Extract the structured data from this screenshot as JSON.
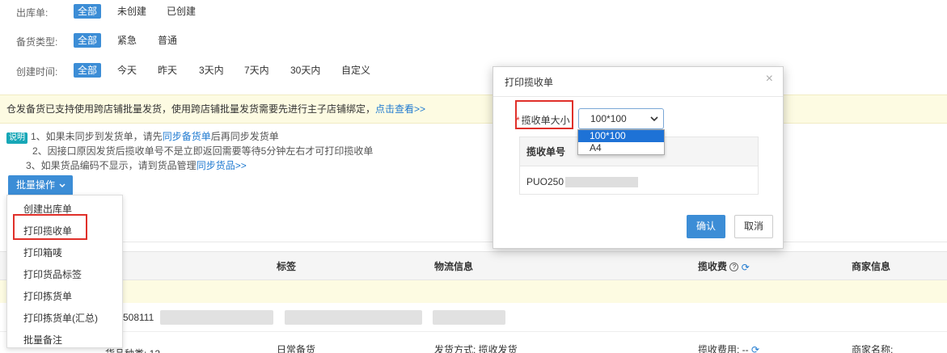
{
  "filters": {
    "outbound": {
      "label": "出库单:",
      "options": [
        "全部",
        "未创建",
        "已创建"
      ],
      "active": "全部"
    },
    "stock_type": {
      "label": "备货类型:",
      "options": [
        "全部",
        "紧急",
        "普通"
      ],
      "active": "全部"
    },
    "created_time": {
      "label": "创建时间:",
      "options": [
        "全部",
        "今天",
        "昨天",
        "3天内",
        "7天内",
        "30天内",
        "自定义"
      ],
      "active": "全部"
    }
  },
  "notice": {
    "text": "仓发备货已支持使用跨店铺批量发货，使用跨店铺批量发货需要先进行主子店铺绑定，",
    "link": "点击查看>>"
  },
  "tips": {
    "badge": "说明",
    "line1_pre": "1、如果未同步到发货单，请先",
    "line1_link": "同步备货单",
    "line1_post": "后再同步发货单",
    "line2": "2、因接口原因发货后揽收单号不是立即返回需要等待5分钟左右才可打印揽收单",
    "line3_pre": "3、如果货品编码不显示，请到货品管理",
    "line3_link": "同步货品>>"
  },
  "batch_button": {
    "label": "批量操作",
    "chevron": "chevron-down-icon"
  },
  "batch_menu": [
    "创建出库单",
    "打印揽收单",
    "打印箱唛",
    "打印货品标签",
    "打印拣货单",
    "打印拣货单(汇总)",
    "批量备注"
  ],
  "table": {
    "headers": [
      "标签",
      "物流信息",
      "揽收费",
      "商家信息"
    ],
    "row": {
      "id_partial": "508111",
      "goods_kinds": "货品种类: 12",
      "stock_type": "日常备货",
      "ship_method": "发货方式: 揽收发货",
      "pickup_fee": "揽收费用: --",
      "merchant_name": "商家名称:"
    }
  },
  "modal": {
    "title": "打印揽收单",
    "close": "×",
    "field_label": "揽收单大小",
    "selected": "100*100",
    "options": [
      "100*100",
      "A4"
    ],
    "table_header": "揽收单号",
    "table_value": "PUO250",
    "confirm": "确认",
    "cancel": "取消"
  },
  "colors": {
    "accent": "#3c8dd6",
    "highlight": "#e0302a",
    "notice_bg": "#fdfbe2"
  }
}
